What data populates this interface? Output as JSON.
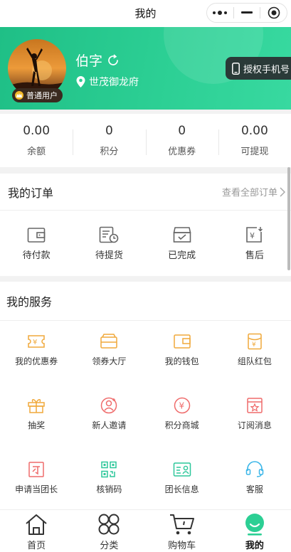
{
  "window": {
    "title": "我的"
  },
  "header": {
    "username": "伯字",
    "location": "世茂御龙府",
    "member_badge": "普通用户",
    "bind_phone": "授权手机号",
    "brand_color": "#2ccf94"
  },
  "stats": [
    {
      "value": "0.00",
      "label": "余额"
    },
    {
      "value": "0",
      "label": "积分"
    },
    {
      "value": "0",
      "label": "优惠券"
    },
    {
      "value": "0.00",
      "label": "可提现"
    }
  ],
  "orders": {
    "title": "我的订单",
    "view_all": "查看全部订单",
    "items": [
      {
        "label": "待付款",
        "icon": "wallet-icon"
      },
      {
        "label": "待提货",
        "icon": "pickup-icon"
      },
      {
        "label": "已完成",
        "icon": "completed-box-icon"
      },
      {
        "label": "售后",
        "icon": "after-sales-icon"
      }
    ]
  },
  "services": {
    "title": "我的服务",
    "items": [
      {
        "label": "我的优惠券",
        "icon": "coupon-icon",
        "color": "#f0a93b"
      },
      {
        "label": "领券大厅",
        "icon": "coupon-hall-icon",
        "color": "#f0a93b"
      },
      {
        "label": "我的钱包",
        "icon": "wallet-icon",
        "color": "#f0a93b"
      },
      {
        "label": "组队红包",
        "icon": "red-packet-icon",
        "color": "#f0a93b"
      },
      {
        "label": "抽奖",
        "icon": "gift-icon",
        "color": "#f0a93b"
      },
      {
        "label": "新人邀请",
        "icon": "invite-user-icon",
        "color": "#ef6b6b"
      },
      {
        "label": "积分商城",
        "icon": "points-mall-icon",
        "color": "#ef6b6b"
      },
      {
        "label": "订阅消息",
        "icon": "subscribe-icon",
        "color": "#ef6b6b"
      },
      {
        "label": "申请当团长",
        "icon": "apply-leader-icon",
        "color": "#ef6b6b"
      },
      {
        "label": "核销码",
        "icon": "qr-code-icon",
        "color": "#2cc79a"
      },
      {
        "label": "团长信息",
        "icon": "leader-card-icon",
        "color": "#2cc79a"
      },
      {
        "label": "客服",
        "icon": "headset-icon",
        "color": "#3bb6e8"
      }
    ]
  },
  "tabbar": [
    {
      "label": "首页",
      "icon": "home-icon"
    },
    {
      "label": "分类",
      "icon": "category-icon"
    },
    {
      "label": "购物车",
      "icon": "cart-icon"
    },
    {
      "label": "我的",
      "icon": "profile-icon",
      "active": true
    }
  ]
}
